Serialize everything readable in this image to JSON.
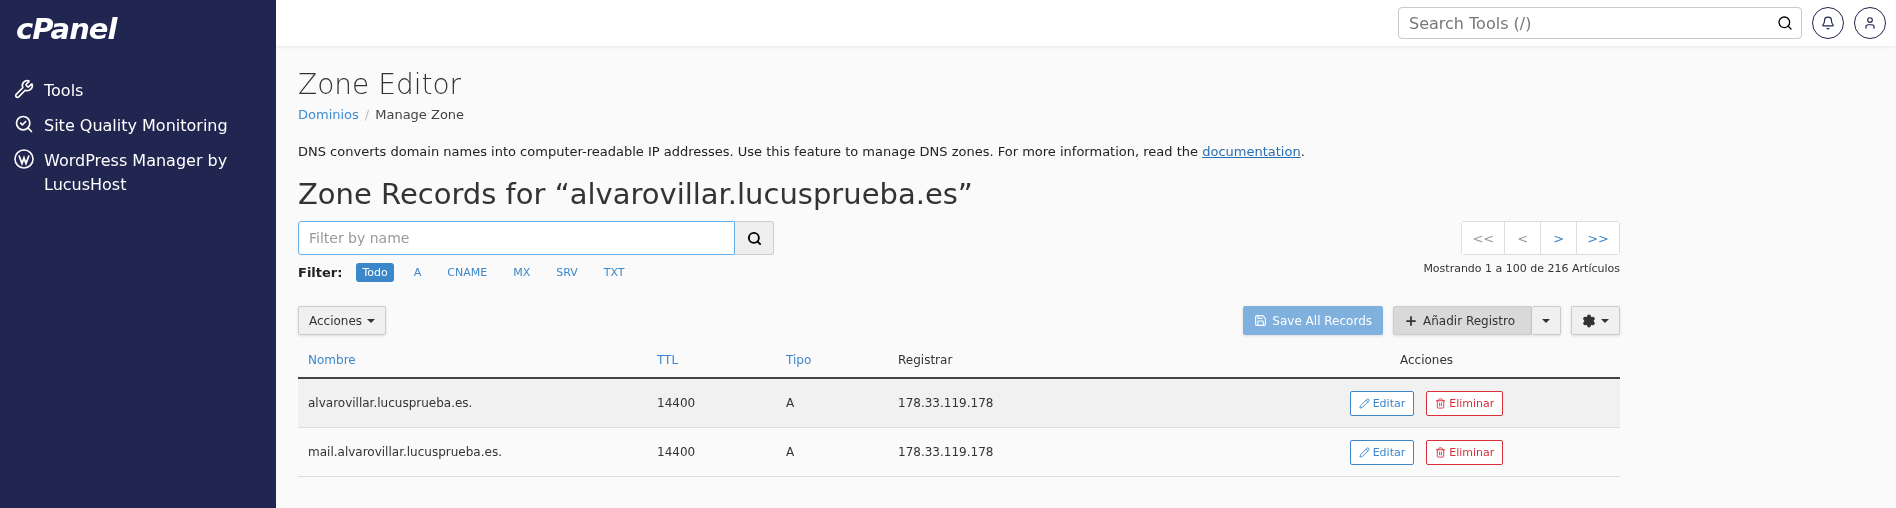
{
  "sidebar": {
    "logo": "cPanel",
    "items": [
      {
        "label": "Tools"
      },
      {
        "label": "Site Quality Monitoring"
      },
      {
        "label": "WordPress Manager by LucusHost"
      }
    ]
  },
  "topbar": {
    "search": {
      "placeholder": "Search Tools (/)"
    }
  },
  "page": {
    "title": "Zone Editor",
    "breadcrumb_separator": "/",
    "breadcrumb": [
      {
        "label": "Dominios",
        "link": true
      },
      {
        "label": "Manage Zone",
        "link": false
      }
    ],
    "description": {
      "text": "DNS converts domain names into computer-readable IP addresses. Use this feature to manage DNS zones. For more information, read the ",
      "link": "documentation",
      "end": "."
    },
    "heading": "Zone Records for “alvarovillar.lucusprueba.es”"
  },
  "filter": {
    "search": {
      "placeholder": "Filter by name"
    },
    "label": "Filter:",
    "types": [
      {
        "label": "Todo",
        "selected": true
      },
      {
        "label": "A",
        "selected": false
      },
      {
        "label": "CNAME",
        "selected": false
      },
      {
        "label": "MX",
        "selected": false
      },
      {
        "label": "SRV",
        "selected": false
      },
      {
        "label": "TXT",
        "selected": false
      }
    ]
  },
  "pagination": {
    "buttons": [
      {
        "label": "<<",
        "disabled": true
      },
      {
        "label": "<",
        "disabled": true
      },
      {
        "label": ">",
        "disabled": false
      },
      {
        "label": ">>",
        "disabled": false
      }
    ],
    "summary": "Mostrando 1 a 100 de 216 Artículos"
  },
  "toolbar": {
    "actions": "Acciones",
    "save": "Save All Records",
    "add": "Añadir Registro"
  },
  "table": {
    "columns": [
      {
        "label": "Nombre",
        "sortable": true
      },
      {
        "label": "TTL",
        "sortable": true
      },
      {
        "label": "Tipo",
        "sortable": true
      },
      {
        "label": "Registrar",
        "sortable": false
      },
      {
        "label": "Acciones",
        "sortable": false
      }
    ],
    "rows": [
      {
        "name": "alvarovillar.lucusprueba.es.",
        "ttl": "14400",
        "type": "A",
        "record": "178.33.119.178",
        "edit": "Editar",
        "delete": "Eliminar"
      },
      {
        "name": "mail.alvarovillar.lucusprueba.es.",
        "ttl": "14400",
        "type": "A",
        "record": "178.33.119.178",
        "edit": "Editar",
        "delete": "Eliminar"
      }
    ]
  }
}
